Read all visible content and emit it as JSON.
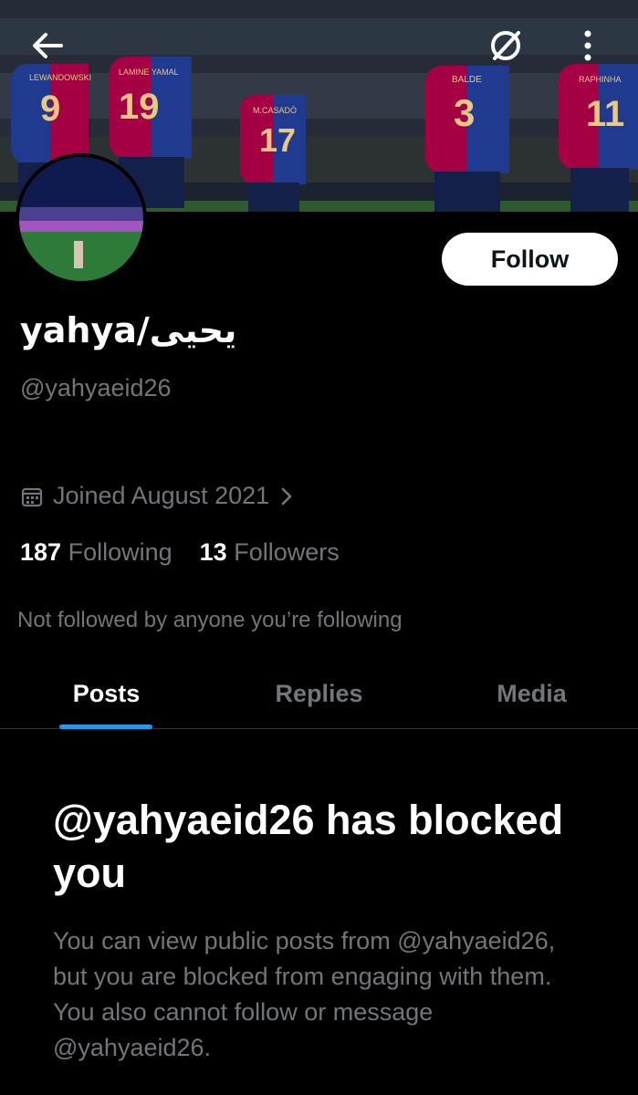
{
  "header": {
    "back_icon": "arrow-left-icon",
    "block_icon": "no-entry-icon",
    "more_icon": "more-vertical-icon",
    "banner_jerseys": [
      {
        "name": "LEWANDOWSKI",
        "number": "9"
      },
      {
        "name": "LAMINE YAMAL",
        "number": "19"
      },
      {
        "name": "M.CASADÓ",
        "number": "17"
      },
      {
        "name": "BALDE",
        "number": "3"
      },
      {
        "name": "RAPHINHA",
        "number": "11"
      }
    ]
  },
  "profile": {
    "display_name": "yahya/يحيى",
    "handle": "@yahyaeid26",
    "follow_label": "Follow",
    "joined": "Joined August 2021",
    "following_count": "187",
    "following_label": "Following",
    "followers_count": "13",
    "followers_label": "Followers",
    "not_followed": "Not followed by anyone you’re following"
  },
  "tabs": [
    {
      "label": "Posts",
      "active": true
    },
    {
      "label": "Replies",
      "active": false
    },
    {
      "label": "Media",
      "active": false
    }
  ],
  "blocked": {
    "title": "@yahyaeid26 has blocked you",
    "message": "You can view public posts from @yahyaeid26, but you are blocked from engaging with them. You also cannot follow or message @yahyaeid26."
  },
  "colors": {
    "background": "#000000",
    "accent": "#1d9bf0",
    "muted": "#71767b"
  }
}
